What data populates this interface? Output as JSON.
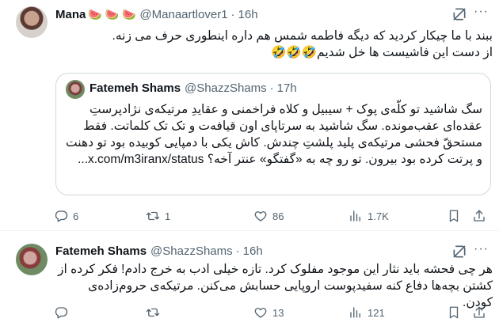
{
  "tweet1": {
    "name": "Mana",
    "emoji": "🍉 🍉 🍉",
    "handle": "@Manaartlover1",
    "time": "16h",
    "text_line1": "ببند با ما چیکار کردید که دیگه فاطمه شمس هم داره اینطوری حرف می زنه.",
    "text_line2": "از دست این فاشیست ها خل شدیم🤣🤣🤣",
    "quote": {
      "name": "Fatemeh Shams",
      "handle": "@ShazzShams",
      "time": "17h",
      "text": "سگ شاشید تو کلّه‌ی پوک + سیبیل و کلاه فراخمنی و عقایدِ مرتیکه‌ی نژادپرستِ عقده‌ای عقب‌مونده. سگ شاشید به سرتاپای اون قیافه‌ت و تک تک کلماتت. فقط مستحقّ فحشی مرتیکه‌ی پلید پلشتِ چندش. کاش یکی با دمپایی کوبیده بود تو دهنت و پرتت کرده بود بیرون. تو رو چه به «گفتگو» عنتر آخه؟ x.com/m3iranx/status..."
    },
    "actions": {
      "replies": "6",
      "retweets": "1",
      "likes": "86",
      "views": "1.7K"
    }
  },
  "tweet2": {
    "name": "Fatemeh Shams",
    "handle": "@ShazzShams",
    "time": "16h",
    "text": "هر چی فحشه باید نثار این موجود مفلوک کرد. تازه خیلی ادب به خرج دادم! فکر کرده از کشتن بچه‌ها دفاع کنه سفیدپوست اروپایی حسابش می‌کنن. مرتیکه‌ی حروم‌زاده‌ی کودن.",
    "actions": {
      "replies": "",
      "retweets": "",
      "likes": "13",
      "views": "121"
    }
  },
  "icons": [
    "grok-icon",
    "more-icon",
    "reply-icon",
    "retweet-icon",
    "like-icon",
    "views-icon",
    "bookmark-icon",
    "share-icon"
  ]
}
